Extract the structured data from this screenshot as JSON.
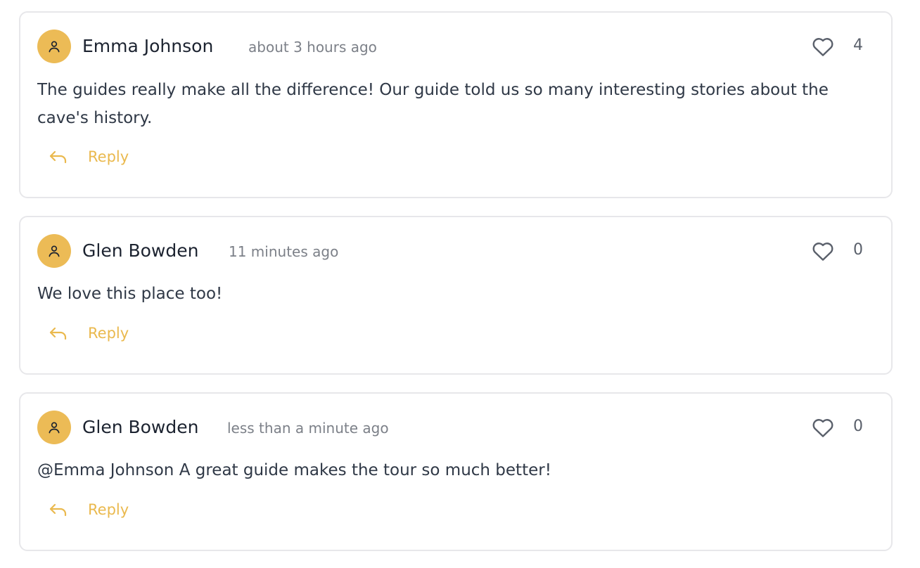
{
  "colors": {
    "accent": "#ecbb56",
    "reply_text": "#eab94e",
    "border": "#e7e7ea",
    "muted": "#7c8088"
  },
  "comments": [
    {
      "author": "Emma Johnson",
      "time": "about 3 hours ago",
      "likes": "4",
      "text": "The guides really make all the difference! Our guide told us so many interesting stories about the cave's history.",
      "reply_label": "Reply",
      "avatar_icon": "user-icon",
      "like_icon": "heart-icon",
      "reply_icon": "reply-arrow-icon"
    },
    {
      "author": "Glen Bowden",
      "time": "11 minutes ago",
      "likes": "0",
      "text": "We love this place too!",
      "reply_label": "Reply",
      "avatar_icon": "user-icon",
      "like_icon": "heart-icon",
      "reply_icon": "reply-arrow-icon"
    },
    {
      "author": "Glen Bowden",
      "time": "less than a minute ago",
      "likes": "0",
      "text": "@Emma Johnson A great guide makes the tour so much better!",
      "reply_label": "Reply",
      "avatar_icon": "user-icon",
      "like_icon": "heart-icon",
      "reply_icon": "reply-arrow-icon"
    }
  ]
}
